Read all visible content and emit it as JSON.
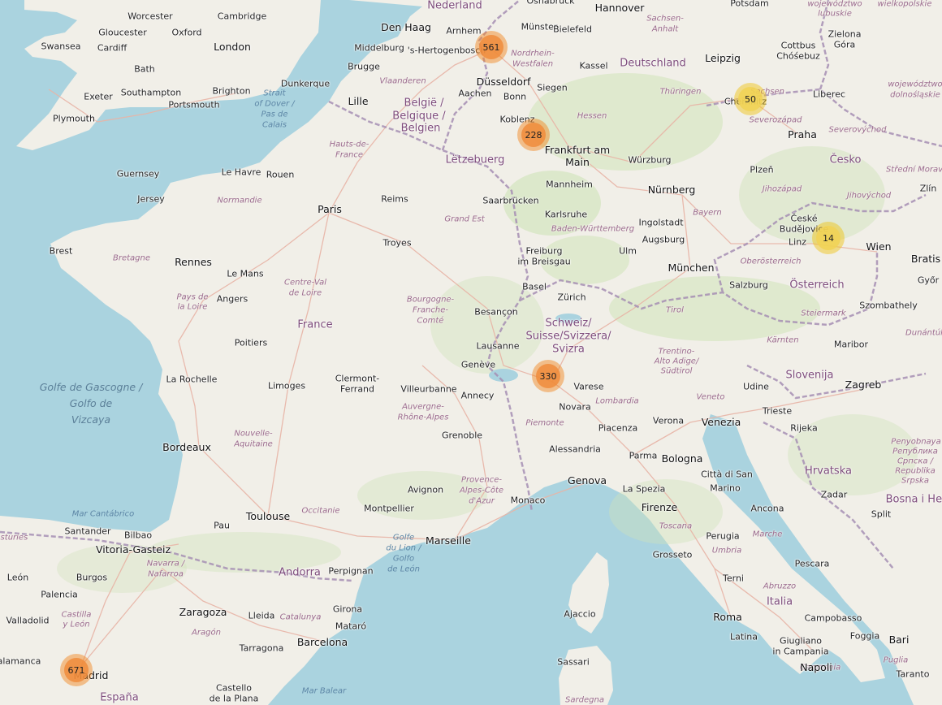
{
  "map": {
    "colors": {
      "water": "#aad3df",
      "land": "#f1efe8",
      "forest": "#cfe3b8",
      "border": "#a68fb4",
      "road": "#e8b4a6"
    },
    "clusters": [
      {
        "count": "561",
        "tone": "orange"
      },
      {
        "count": "228",
        "tone": "orange"
      },
      {
        "count": "50",
        "tone": "yellow"
      },
      {
        "count": "14",
        "tone": "yellow"
      },
      {
        "count": "330",
        "tone": "orange"
      },
      {
        "count": "671",
        "tone": "orange"
      }
    ],
    "countries": {
      "france": "France",
      "deutschland": "Deutschland",
      "belgie_1": "België /",
      "belgie_2": "Belgique /",
      "belgie_3": "Belgien",
      "nederland": "Nederland",
      "letzebuerg": "Lëtzebuerg",
      "schweiz_1": "Schweiz/",
      "schweiz_2": "Suisse/Svizzera/",
      "schweiz_3": "Svizra",
      "osterreich": "Österreich",
      "cesko": "Česko",
      "italia": "Italia",
      "slovenija": "Slovenija",
      "hrvatska": "Hrvatska",
      "bosna": "Bosna i Her",
      "espana": "España",
      "andorra": "Andorra",
      "monaco": "Monaco",
      "san_marino_1": "Città di San",
      "san_marino_2": "Marino"
    },
    "seas": {
      "gascogne_1": "Golfe de Gascogne /",
      "gascogne_2": "Golfo de",
      "gascogne_3": "Vizcaya",
      "cantabrico": "Mar Cantábrico",
      "balear": "Mar Balear",
      "lion_1": "Golfe",
      "lion_2": "du Lion /",
      "lion_3": "Golfo",
      "lion_4": "de León",
      "dover_1": "Strait",
      "dover_2": "of Dover /",
      "dover_3": "Pas de",
      "dover_4": "Calais"
    },
    "regions": {
      "normandie": "Normandie",
      "bretagne": "Bretagne",
      "hauts_1": "Hauts-de-",
      "hauts_2": "France",
      "grand_est": "Grand Est",
      "pdl_1": "Pays de",
      "pdl_2": "la Loire",
      "cvl_1": "Centre-Val",
      "cvl_2": "de Loire",
      "bfc_1": "Bourgogne-",
      "bfc_2": "Franche-",
      "bfc_3": "Comté",
      "na_1": "Nouvelle-",
      "na_2": "Aquitaine",
      "ara_1": "Auvergne-",
      "ara_2": "Rhône-Alpes",
      "occitanie": "Occitanie",
      "paca_1": "Provence-",
      "paca_2": "Alpes-Côte",
      "paca_3": "d'Azur",
      "vlaanderen": "Vlaanderen",
      "nrw_1": "Nordrhein-",
      "nrw_2": "Westfalen",
      "hessen": "Hessen",
      "bw": "Baden-Württemberg",
      "bayern": "Bayern",
      "thuringen": "Thüringen",
      "sachsen_anhalt_1": "Sachsen-",
      "sachsen_anhalt_2": "Anhalt",
      "sachsen": "Sachsen",
      "severozapad": "Severozápad",
      "severovychod": "Severovýchod",
      "strední_1": "Střední Morav",
      "jihozapad": "Jihozápad",
      "jihovychod": "Jihovýchod",
      "oberosterreich": "Oberösterreich",
      "steiermark": "Steiermark",
      "karnten": "Kärnten",
      "tirol": "Tirol",
      "trentino_1": "Trentino-",
      "trentino_2": "Alto Adige/",
      "trentino_3": "Südtirol",
      "lombardia": "Lombardia",
      "piemonte": "Piemonte",
      "veneto": "Veneto",
      "toscana": "Toscana",
      "umbria": "Umbria",
      "abruzzo": "Abruzzo",
      "marche": "Marche",
      "campania": "Campania",
      "puglia": "Puglia",
      "sardegna": "Sardegna",
      "wojlub_1": "województwo",
      "wojlub_2": "lubuskie",
      "wojdol_1": "województwo",
      "wojdol_2": "dolnośląskie",
      "wielkopol": "wielkopolskie",
      "rs_1": "Република",
      "rs_2": "Српска /",
      "rs_3": "Republika",
      "rs_4": "Srpska",
      "penyb": "Penyobnaya",
      "navarra_1": "Navarra /",
      "navarra_2": "Nafarroa",
      "castilla_1": "Castilla",
      "castilla_2": "y León",
      "aragon": "Aragón",
      "catalunya": "Catalunya",
      "asturies": "Asturies",
      "dunantul": "Dunántúl"
    },
    "cities": {
      "swansea": "Swansea",
      "cardiff": "Cardiff",
      "gloucester": "Gloucester",
      "oxford": "Oxford",
      "worcester": "Worcester",
      "cambridge": "Cambridge",
      "london": "London",
      "bath": "Bath",
      "exeter": "Exeter",
      "southampton": "Southampton",
      "brighton": "Brighton",
      "portsmouth": "Portsmouth",
      "plymouth": "Plymouth",
      "guernsey": "Guernsey",
      "jersey": "Jersey",
      "den_haag": "Den Haag",
      "middelburg": "Middelburg",
      "brugge": "Brugge",
      "dunkerque": "Dunkerque",
      "lille": "Lille",
      "s_hertogenbosch": "'s-Hertogenbosch",
      "arnhem": "Arnhem",
      "munster": "Münster",
      "osnabruck": "Osnabrück",
      "hannover": "Hannover",
      "potsdam": "Potsdam",
      "bielefeld": "Bielefeld",
      "kassel": "Kassel",
      "dusseldorf": "Düsseldorf",
      "aachen": "Aachen",
      "bonn": "Bonn",
      "siegen": "Siegen",
      "koblenz": "Koblenz",
      "leipzig": "Leipzig",
      "cottbus_1": "Cottbus",
      "cottbus_2": "Chóśebuz",
      "zielona_1": "Zielona",
      "zielona_2": "Góra",
      "chemnitz": "Chemnitz",
      "liberec": "Liberec",
      "praha": "Praha",
      "plzen": "Plzeň",
      "ceske_1": "České",
      "ceske_2": "Budějovice",
      "linz": "Linz",
      "wien": "Wien",
      "bratis": "Bratis",
      "gyor": "Győr",
      "szombathely": "Szombathely",
      "zlin": "Zlín",
      "frankfurt_1": "Frankfurt am",
      "frankfurt_2": "Main",
      "wurzburg": "Würzburg",
      "mannheim": "Mannheim",
      "nurnberg": "Nürnberg",
      "saarbrucken": "Saarbrücken",
      "karlsruhe": "Karlsruhe",
      "ingolstadt": "Ingolstadt",
      "augsburg": "Augsburg",
      "ulm": "Ulm",
      "munchen": "München",
      "freiburg_1": "Freiburg",
      "freiburg_2": "im Breisgau",
      "basel": "Basel",
      "zurich": "Zürich",
      "salzburg": "Salzburg",
      "le_havre": "Le Havre",
      "rouen": "Rouen",
      "reims": "Reims",
      "paris": "Paris",
      "brest": "Brest",
      "rennes": "Rennes",
      "le_mans": "Le Mans",
      "angers": "Angers",
      "troyes": "Troyes",
      "besancon": "Besançon",
      "lausanne": "Lausanne",
      "geneve": "Genève",
      "annecy": "Annecy",
      "poitiers": "Poitiers",
      "la_rochelle": "La Rochelle",
      "limoges": "Limoges",
      "clermont_1": "Clermont-",
      "clermont_2": "Ferrand",
      "villeurbanne": "Villeurbanne",
      "grenoble": "Grenoble",
      "bordeaux": "Bordeaux",
      "toulouse": "Toulouse",
      "pau": "Pau",
      "montpellier": "Montpellier",
      "avignon": "Avignon",
      "marseille": "Marseille",
      "perpignan": "Perpignan",
      "varese": "Varese",
      "novara": "Novara",
      "piacenza": "Piacenza",
      "alessandria": "Alessandria",
      "genova": "Genova",
      "la_spezia": "La Spezia",
      "parma": "Parma",
      "bologna": "Bologna",
      "verona": "Verona",
      "venezia": "Venezia",
      "udine": "Udine",
      "trieste": "Trieste",
      "rijeka": "Rijeka",
      "maribor": "Maribor",
      "zagreb": "Zagreb",
      "zadar": "Zadar",
      "split": "Split",
      "firenze": "Firenze",
      "perugia": "Perugia",
      "grosseto": "Grosseto",
      "terni": "Terni",
      "ancona": "Ancona",
      "pescara": "Pescara",
      "roma": "Roma",
      "latina": "Latina",
      "campobasso": "Campobasso",
      "foggia": "Foggia",
      "bari": "Bari",
      "taranto": "Taranto",
      "giugliano_1": "Giugliano",
      "giugliano_2": "in Campania",
      "napoli": "Napoli",
      "ajaccio": "Ajaccio",
      "sassari": "Sassari",
      "santander": "Santander",
      "bilbao": "Bilbao",
      "vitoria": "Vitoria-Gasteiz",
      "leon": "León",
      "burgos": "Burgos",
      "palencia": "Palencia",
      "valladolid": "Valladolid",
      "salamanca": "Salamanca",
      "madrid": "Madrid",
      "zaragoza": "Zaragoza",
      "lleida": "Lleida",
      "girona": "Girona",
      "mataro": "Mataró",
      "barcelona": "Barcelona",
      "tarragona": "Tarragona",
      "castello_1": "Castello",
      "castello_2": "de la Plana"
    }
  }
}
